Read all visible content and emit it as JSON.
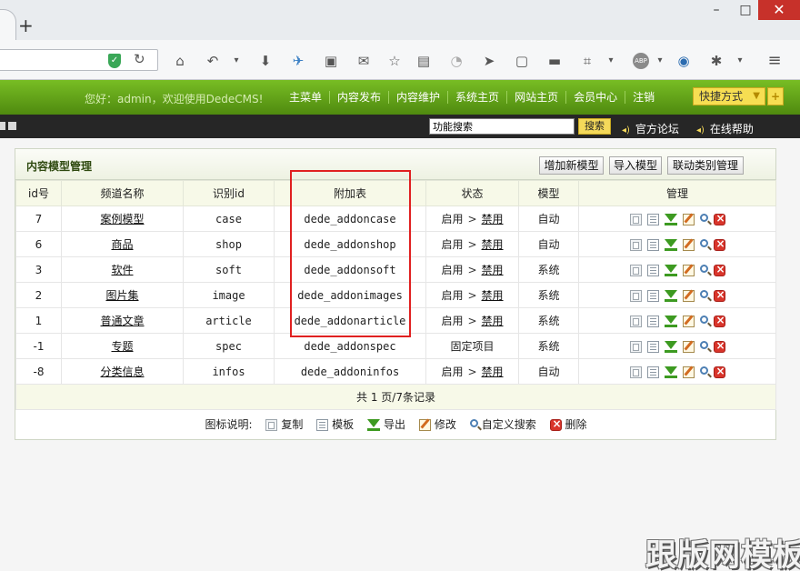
{
  "browser": {
    "new_tab": "+",
    "window_controls": {
      "minimize": "–",
      "maximize": "□",
      "close": "✕"
    },
    "toolbar_icons": [
      "home-icon",
      "back-icon",
      "download-icon",
      "bird-icon",
      "reader-icon",
      "mail-icon",
      "star-icon",
      "clipboard-icon",
      "rss-icon",
      "send-icon",
      "window-icon",
      "folder-icon",
      "crop-icon",
      "abp-icon",
      "globe-icon",
      "extension-icon",
      "menu-icon"
    ],
    "abp_label": "ABP"
  },
  "header": {
    "greeting": "您好：admin，欢迎使用DedeCMS!",
    "nav": [
      "主菜单",
      "内容发布",
      "内容维护",
      "系统主页",
      "网站主页",
      "会员中心",
      "注销"
    ],
    "quick_menu": "快捷方式",
    "quick_add": "+"
  },
  "subbar": {
    "search_value": "功能搜索",
    "search_button": "搜索",
    "forum_link": "官方论坛",
    "help_link": "在线帮助"
  },
  "panel": {
    "title": "内容模型管理",
    "buttons": {
      "add": "增加新模型",
      "import": "导入模型",
      "linkage": "联动类别管理"
    },
    "columns": [
      "id号",
      "频道名称",
      "识别id",
      "附加表",
      "状态",
      "模型",
      "管理"
    ],
    "rows": [
      {
        "id": "7",
        "name": "案例模型",
        "nid": "case",
        "table": "dede_addoncase",
        "state": "启用",
        "gt": ">",
        "action": "禁用",
        "model": "自动"
      },
      {
        "id": "6",
        "name": "商品",
        "nid": "shop",
        "table": "dede_addonshop",
        "state": "启用",
        "gt": ">",
        "action": "禁用",
        "model": "自动"
      },
      {
        "id": "3",
        "name": "软件",
        "nid": "soft",
        "table": "dede_addonsoft",
        "state": "启用",
        "gt": ">",
        "action": "禁用",
        "model": "系统"
      },
      {
        "id": "2",
        "name": "图片集",
        "nid": "image",
        "table": "dede_addonimages",
        "state": "启用",
        "gt": ">",
        "action": "禁用",
        "model": "系统"
      },
      {
        "id": "1",
        "name": "普通文章",
        "nid": "article",
        "table": "dede_addonarticle",
        "state": "启用",
        "gt": ">",
        "action": "禁用",
        "model": "系统"
      },
      {
        "id": "-1",
        "name": "专题",
        "nid": "spec",
        "table": "dede_addonspec",
        "state": "固定项目",
        "gt": "",
        "action": "",
        "model": "系统"
      },
      {
        "id": "-8",
        "name": "分类信息",
        "nid": "infos",
        "table": "dede_addoninfos",
        "state": "启用",
        "gt": ">",
        "action": "禁用",
        "model": "自动"
      }
    ],
    "pager": "共 1 页/7条记录",
    "legend": {
      "label": "图标说明:",
      "copy": "复制",
      "template": "模板",
      "export": "导出",
      "edit": "修改",
      "search": "自定义搜索",
      "delete": "删除"
    }
  },
  "watermark": "跟版网模板",
  "colors": {
    "header_green": "#5f9e16",
    "dark_bar": "#262626",
    "highlight_red": "#e02020",
    "quick_yellow": "#f6de52"
  }
}
